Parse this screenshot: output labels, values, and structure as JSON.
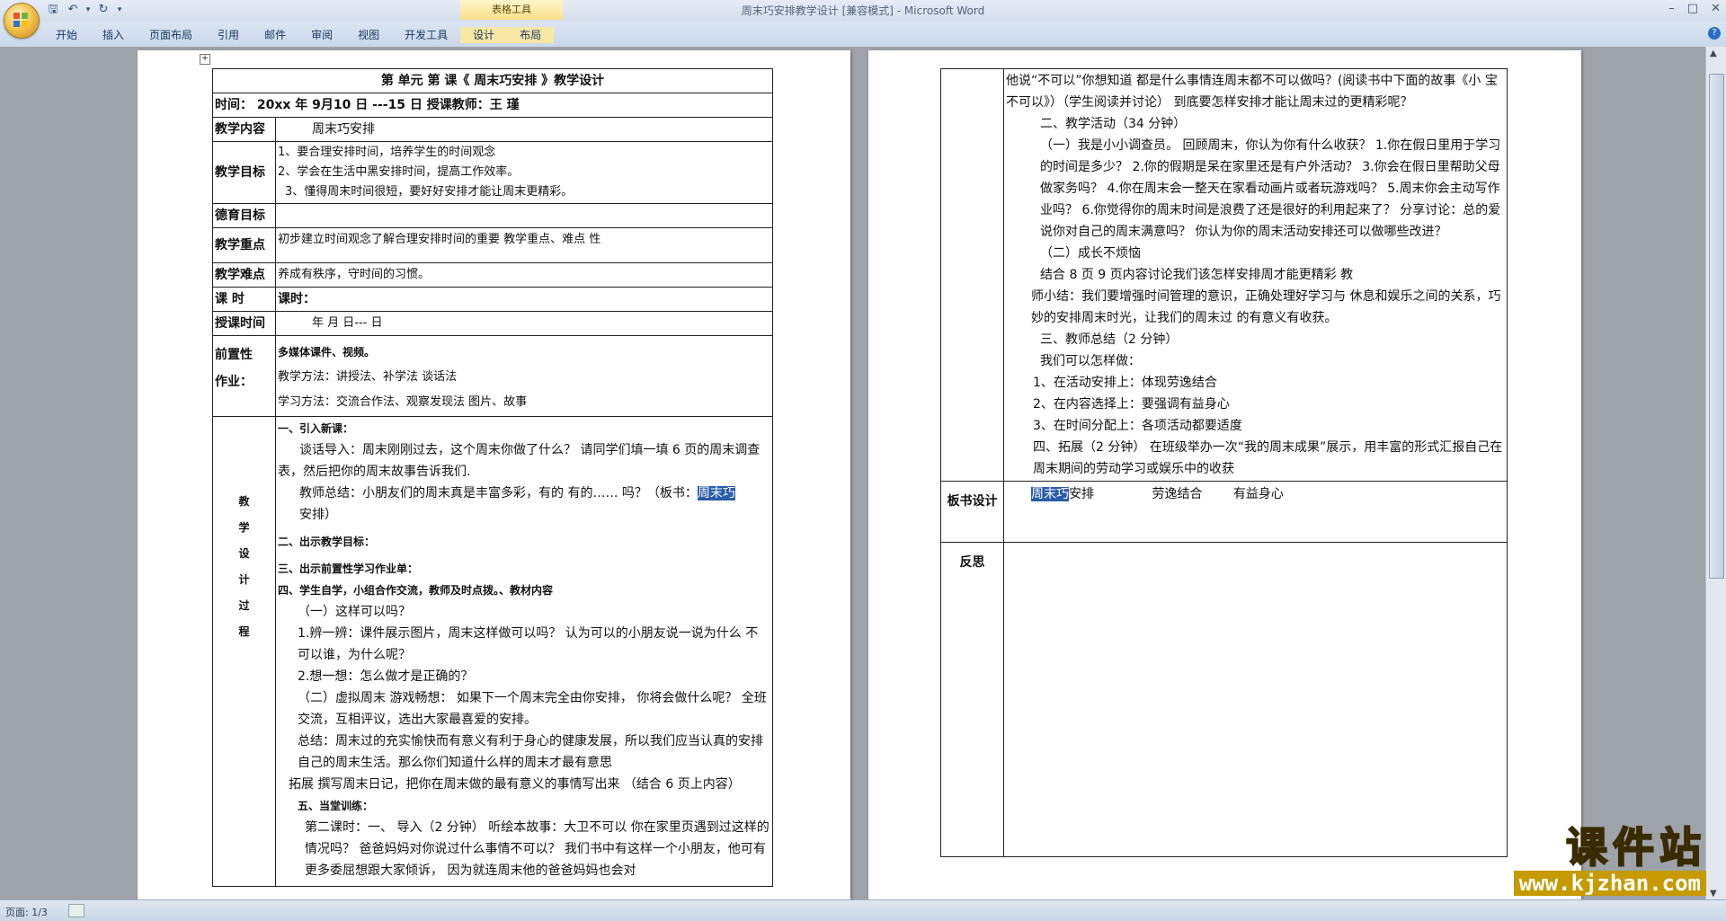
{
  "window": {
    "title": "周末巧安排教学设计 [兼容模式] - Microsoft Word",
    "context_tab_group": "表格工具"
  },
  "ribbon": {
    "tabs": [
      "开始",
      "插入",
      "页面布局",
      "引用",
      "邮件",
      "审阅",
      "视图",
      "开发工具",
      "设计",
      "布局"
    ]
  },
  "status": {
    "page": "页面: 1/3"
  },
  "watermark": {
    "big": "课件站",
    "small": "www.kjzhan.com"
  },
  "left": {
    "header": "第  单元     第  课《  周末巧安排  》教学设计",
    "time_row": "时间：  20xx 年  9月10 日 ---15 日     授课教师：王  瑾",
    "content_label": "教学内容",
    "content_value": "周末巧安排",
    "goal_label": "教学目标",
    "goals": [
      "1、要合理安排时间，培养学生的时间观念",
      "2、学会在生活中黑安排时间，提高工作效率。",
      "3、懂得周末时间很短，要好好安排才能让周末更精彩。"
    ],
    "moral_label": "德育目标",
    "key_label": "教学重点",
    "key_value": "初步建立时间观念了解合理安排时间的重要 教学重点、难点 性",
    "diff_label": "教学难点",
    "diff_value": "养成有秩序，守时间的习惯。",
    "lesson_label": "课    时",
    "lesson_value": "课时：",
    "date_label": "授课时间",
    "date_value": "年    月    日---  日",
    "pre_label1": "前置性",
    "pre_label2": "作业：",
    "pre_lines": [
      "多媒体课件、视频。",
      "教学方法：讲授法、补学法 谈话法",
      "学习方法：交流合作法、观察发现法 图片、故事"
    ],
    "process_chars": [
      "教",
      "学",
      "设",
      "计",
      "过",
      "程"
    ],
    "process": {
      "s1_title": "一、引入新课：",
      "s1_p1": "谈话导入：周末刚刚过去，这个周末你做了什么？ 请同学们填一填 6 页的周末调查表，然后把你的周末故事告诉我们.",
      "s1_p2a": "教师总结：小朋友们的周末真是丰富多彩，有的 有的…… 吗？（板书：",
      "s1_p2sel": "周末巧",
      "s1_p2b": "安排）",
      "s2_title": "二、出示教学目标：",
      "s3_title": "三、出示前置性学习作业单：",
      "s4_title": "四、学生自学，小组合作交流，教师及时点拨。、教材内容",
      "s4_q1": "（一）这样可以吗？",
      "s4_q1a": "1.辨一辨：课件展示图片，周末这样做可以吗？ 认为可以的小朋友说一说为什么 不可以谁，为什么呢？",
      "s4_q1b": "2.想一想：怎么做才是正确的？",
      "s4_q2": "（二）虚拟周末 游戏畅想： 如果下一个周末完全由你安排， 你将会做什么呢？ 全班交流，互相评议，选出大家最喜爱的安排。",
      "s4_sum": "总结：周末过的充实愉快而有意义有利于身心的健康发展，所以我们应当认真的安排自己的周末生活。那么你们知道什么样的周末才最有意思",
      "s4_ext": "拓展 撰写周末日记，把你在周末做的最有意义的事情写出来 （结合 6 页上内容）",
      "s5_title": "五、当堂训练：",
      "s5_p": "第二课时：一、 导入（2 分钟） 听绘本故事：大卫不可以 你在家里页遇到过这样的情况吗？ 爸爸妈妈对你说过什么事情不可以？ 我们书中有这样一个小朋友，他可有更多委屈想跟大家倾诉， 因为就连周末他的爸爸妈妈也会对"
    }
  },
  "right": {
    "paras": [
      "他说“不可以”你想知道 都是什么事情连周末都不可以做吗？(阅读书中下面的故事《小 宝不可以》）（学生阅读并讨论） 到底要怎样安排才能让周末过的更精彩呢？",
      "二、教学活动（34 分钟）",
      "（一）我是小小调查员。 回顾周末，你认为你有什么收获？ 1.你在假日里用于学习的时间是多少？ 2.你的假期是呆在家里还是有户外活动？ 3.你会在假日里帮助父母做家务吗？ 4.你在周末会一整天在家看动画片或者玩游戏吗？ 5.周末你会主动写作业吗？ 6.你觉得你的周末时间是浪费了还是很好的利用起来了？ 分享讨论：总的爱说你对自己的周末满意吗？ 你认为你的周末活动安排还可以做哪些改进？",
      "（二）成长不烦恼",
      "结合 8 页 9 页内容讨论我们该怎样安排周才能更精彩 教",
      "师小结：我们要增强时间管理的意识，正确处理好学习与 休息和娱乐之间的关系，巧妙的安排周末时光，让我们的周末过 的有意义有收获。",
      "三、教师总结（2 分钟）",
      "我们可以怎样做：",
      "1、在活动安排上：体现劳逸结合",
      "2、在内容选择上：要强调有益身心",
      "3、在时间分配上：各项活动都要适度",
      "四、拓展（2 分钟） 在班级举办一次“我的周末成果”展示，用丰富的形式汇报自己在周末期间的劳动学习或娱乐中的收获"
    ],
    "board_label": "板书设计",
    "board_sel": "周末巧",
    "board_rest": "安排",
    "board_items": [
      "劳逸结合",
      "有益身心"
    ],
    "reflect_label": "反思"
  }
}
